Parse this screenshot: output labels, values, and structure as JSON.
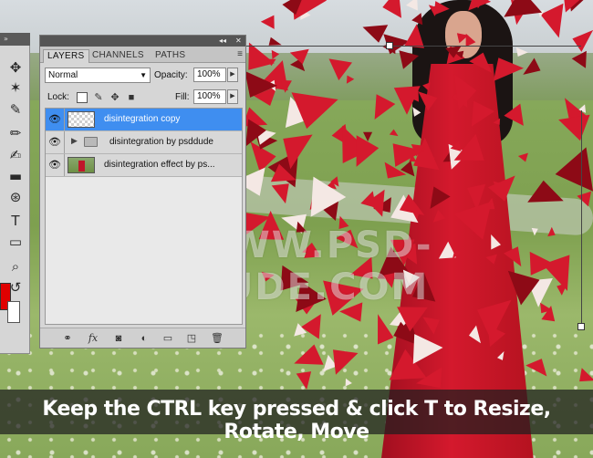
{
  "watermark": "WWW.PSD-DUDE.COM",
  "caption": "Keep the CTRL key pressed & click T to Resize, Rotate, Move",
  "toolbar": {
    "collapse": "»",
    "tools": [
      {
        "icon": "move-icon",
        "glyph": "✥"
      },
      {
        "icon": "magic-wand-icon",
        "glyph": "✶"
      },
      {
        "icon": "eyedropper-icon",
        "glyph": "✎"
      },
      {
        "icon": "brush-icon",
        "glyph": "✏"
      },
      {
        "icon": "history-brush-icon",
        "glyph": "✍"
      },
      {
        "icon": "gradient-icon",
        "glyph": "▬"
      },
      {
        "icon": "pen-icon",
        "glyph": "⊛"
      },
      {
        "icon": "type-icon",
        "glyph": "T"
      },
      {
        "icon": "shape-icon",
        "glyph": "▭"
      },
      {
        "icon": "zoom-icon",
        "glyph": "⌕"
      },
      {
        "icon": "swap-colors-icon",
        "glyph": "↺"
      }
    ],
    "foreground_color": "#e00000",
    "background_color": "#ffffff"
  },
  "panel": {
    "header_controls": [
      "◂◂",
      "✕"
    ],
    "tabs": [
      "LAYERS",
      "CHANNELS",
      "PATHS"
    ],
    "active_tab": "LAYERS",
    "menu_icon": "≡",
    "blend_mode": "Normal",
    "opacity_label": "Opacity:",
    "opacity_value": "100%",
    "lock_label": "Lock:",
    "lock_icons": [
      "lock-transparent-icon",
      "lock-image-icon",
      "lock-position-icon",
      "lock-all-icon"
    ],
    "fill_label": "Fill:",
    "fill_value": "100%",
    "layers": [
      {
        "name": "disintegration copy",
        "selected": true,
        "type": "layer"
      },
      {
        "name": "disintegration by psddude",
        "selected": false,
        "type": "group"
      },
      {
        "name": "disintegration effect by ps...",
        "selected": false,
        "type": "image"
      }
    ],
    "footer_icons": [
      "link-layers-icon",
      "fx-icon",
      "layer-mask-icon",
      "adjustment-layer-icon",
      "new-group-icon",
      "new-layer-icon",
      "trash-icon"
    ]
  },
  "colors": {
    "selection_blue": "#3f8ef0",
    "dress_red": "#d4192d"
  }
}
